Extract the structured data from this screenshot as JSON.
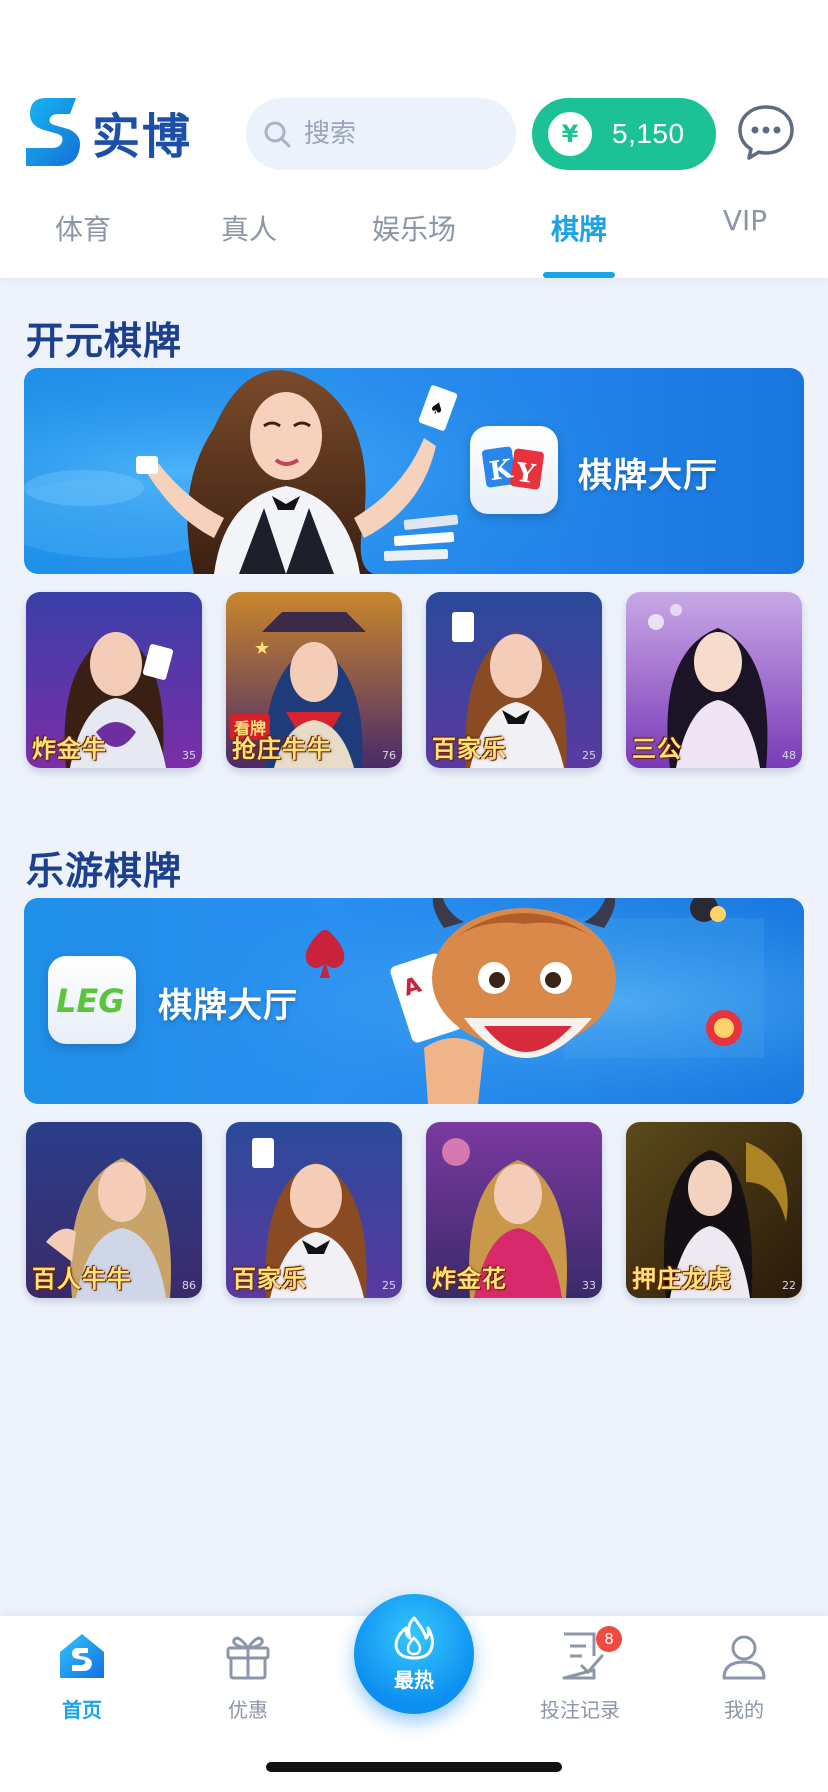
{
  "brand": {
    "name": "实博"
  },
  "search": {
    "placeholder": "搜索"
  },
  "wallet": {
    "currency_symbol": "¥",
    "balance": "5,150"
  },
  "tabs": [
    {
      "label": "体育"
    },
    {
      "label": "真人"
    },
    {
      "label": "娱乐场"
    },
    {
      "label": "棋牌",
      "active": true
    },
    {
      "label": "VIP"
    }
  ],
  "sections": [
    {
      "title": "开元棋牌",
      "lobby_logo": "KY",
      "lobby_label": "棋牌大厅",
      "games": [
        {
          "name": "炸金牛",
          "count": "35"
        },
        {
          "name": "抢庄牛牛",
          "count": "76",
          "tag": "看牌"
        },
        {
          "name": "百家乐",
          "count": "25"
        },
        {
          "name": "三公",
          "count": "48"
        }
      ]
    },
    {
      "title": "乐游棋牌",
      "lobby_logo": "LEG",
      "lobby_label": "棋牌大厅",
      "games": [
        {
          "name": "百人牛牛",
          "count": "86"
        },
        {
          "name": "百家乐",
          "count": "25"
        },
        {
          "name": "炸金花",
          "count": "33"
        },
        {
          "name": "押庄龙虎",
          "count": "22"
        }
      ]
    }
  ],
  "bottom_nav": {
    "items": [
      {
        "label": "首页",
        "icon": "home-icon",
        "active": true
      },
      {
        "label": "优惠",
        "icon": "gift-icon"
      },
      {
        "label": "最热",
        "icon": "flame-icon"
      },
      {
        "label": "投注记录",
        "icon": "bet-record-icon",
        "badge": "8"
      },
      {
        "label": "我的",
        "icon": "profile-icon"
      }
    ]
  },
  "colors": {
    "accent": "#1aa3e8",
    "wallet_green": "#1cc296",
    "title_navy": "#1c3f8e",
    "badge_red": "#f04a41"
  }
}
